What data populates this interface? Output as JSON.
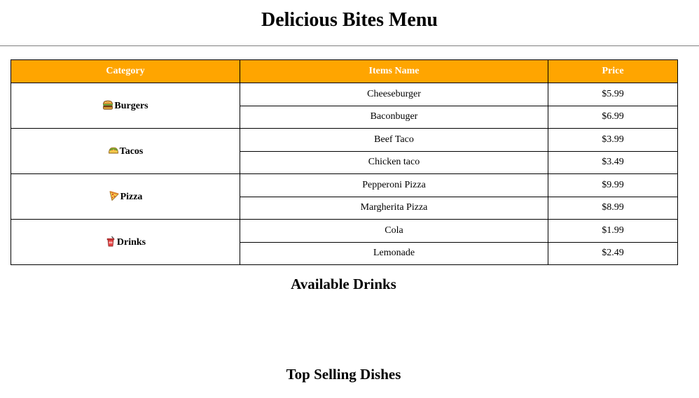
{
  "page": {
    "title": "Delicious Bites Menu"
  },
  "table": {
    "headers": {
      "category": "Category",
      "item": "Items Name",
      "price": "Price"
    },
    "categories": [
      {
        "name": "Burgers",
        "icon": "burger-icon",
        "items": [
          {
            "name": "Cheeseburger",
            "price": "$5.99"
          },
          {
            "name": "Baconbuger",
            "price": "$6.99"
          }
        ]
      },
      {
        "name": "Tacos",
        "icon": "taco-icon",
        "items": [
          {
            "name": "Beef Taco",
            "price": "$3.99"
          },
          {
            "name": "Chicken taco",
            "price": "$3.49"
          }
        ]
      },
      {
        "name": "Pizza",
        "icon": "pizza-icon",
        "items": [
          {
            "name": "Pepperoni Pizza",
            "price": "$9.99"
          },
          {
            "name": "Margherita Pizza",
            "price": "$8.99"
          }
        ]
      },
      {
        "name": "Drinks",
        "icon": "drink-cup-icon",
        "items": [
          {
            "name": "Cola",
            "price": "$1.99"
          },
          {
            "name": "Lemonade",
            "price": "$2.49"
          }
        ]
      }
    ]
  },
  "sections": {
    "available_drinks": "Available Drinks",
    "top_selling": "Top Selling Dishes"
  },
  "colors": {
    "header_background": "#ffa500",
    "header_text": "#ffffff",
    "border": "#000000"
  }
}
